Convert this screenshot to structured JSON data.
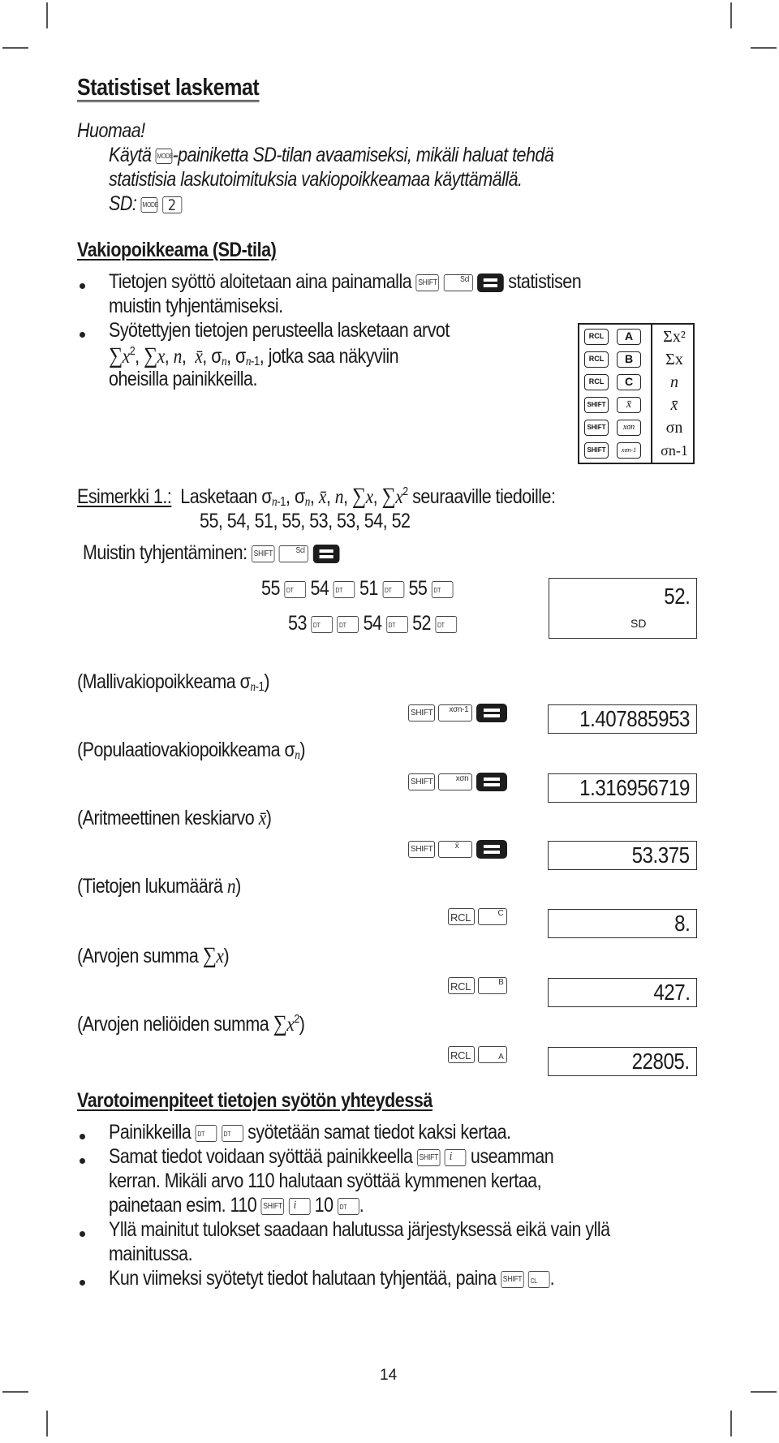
{
  "title": "Statistiset laskemat",
  "note": {
    "heading": "Huomaa!",
    "line1_pre": "Käytä",
    "line1_post": "-painiketta SD-tilan avaamiseksi, mikäli haluat tehdä",
    "line2": "statistisia laskutoimituksia vakiopoikkeamaa käyttämällä.",
    "sd_label": "SD:",
    "mode_key": "MODE",
    "two_key": "2"
  },
  "section1": {
    "heading": "Vakiopoikkeama (SD-tila)",
    "bullet1_pre": "Tietojen syöttö aloitetaan aina painamalla",
    "bullet1_post": "statistisen",
    "bullet1_line2": "muistin tyhjentämiseksi.",
    "bullet2_line1": "Syötettyjen tietojen perusteella lasketaan arvot",
    "bullet2_line2_post": ", jotka saa näkyviin",
    "bullet2_line3": "oheisilla painikkeilla."
  },
  "keys": {
    "shift": "SHIFT",
    "scl": "Scl",
    "dt": "DT",
    "rcl": "RCL",
    "xsn1": "xσn-1",
    "xsn": "xσn",
    "xbar": "x̄",
    "A": "A",
    "B": "B",
    "C": "C",
    "i": "i",
    "cl": "CL"
  },
  "key_table": [
    {
      "k1": "RCL",
      "k2": "A",
      "value": "Σx²"
    },
    {
      "k1": "RCL",
      "k2": "B",
      "value": "Σx"
    },
    {
      "k1": "RCL",
      "k2": "C",
      "value": "n"
    },
    {
      "k1": "SHIFT",
      "k2": "x̄",
      "value": "x̄"
    },
    {
      "k1": "SHIFT",
      "k2": "xσn",
      "value": "σn"
    },
    {
      "k1": "SHIFT",
      "k2": "xσn-1",
      "value": "σn-1"
    }
  ],
  "example": {
    "label": "Esimerkki 1.:",
    "intro_pre": "Lasketaan",
    "intro_post": "seuraaville tiedoille:",
    "data_line": "55, 54, 51, 55, 53, 53, 54, 52",
    "data": [
      55,
      54,
      51,
      55,
      53,
      53,
      54,
      52
    ],
    "clear_label": "Muistin tyhjentäminen:",
    "row1": [
      "55",
      "54",
      "51",
      "55"
    ],
    "row2a": "53",
    "row2b": [
      "54",
      "52"
    ],
    "display_value": "52.",
    "display_indicator": "SD"
  },
  "results": [
    {
      "label": "(Mallivakiopoikkeama σn-1)",
      "value": "1.407885953"
    },
    {
      "label": "(Populaatiovakiopoikkeama σn)",
      "value": "1.316956719"
    },
    {
      "label": "(Aritmeettinen keskiarvo x̄)",
      "value": "53.375"
    },
    {
      "label": "(Tietojen lukumäärä n)",
      "value": "8."
    },
    {
      "label": "(Arvojen summa Σx)",
      "value": "427."
    },
    {
      "label": "(Arvojen neliöiden summa Σx²)",
      "value": "22805."
    }
  ],
  "result_labels": {
    "r0": "(Mallivakiopoikkeama ",
    "r1": "(Populaatiovakiopoikkeama ",
    "r2": "(Aritmeettinen keskiarvo ",
    "r3": "(Tietojen lukumäärä ",
    "r4": "(Arvojen summa ",
    "r5": "(Arvojen neliöiden summa "
  },
  "section2": {
    "heading": "Varotoimenpiteet tietojen syötön yhteydessä",
    "b1_pre": "Painikkeilla",
    "b1_post": "syötetään samat tiedot kaksi kertaa.",
    "b2_pre": "Samat tiedot voidaan syöttää painikkeella",
    "b2_post": "useamman",
    "b2_line2": "kerran. Mikäli arvo 110 halutaan syöttää kymmenen kertaa,",
    "b2_line3_pre": "painetaan esim. 110",
    "b2_line3_mid": "10",
    "b2_line3_post": ".",
    "b3_line1": "Yllä mainitut tulokset saadaan halutussa järjestyksessä eikä vain yllä",
    "b3_line2": "mainitussa.",
    "b4_pre": "Kun viimeksi syötetyt tiedot halutaan tyhjentää, paina",
    "b4_post": "."
  },
  "page_number": "14"
}
